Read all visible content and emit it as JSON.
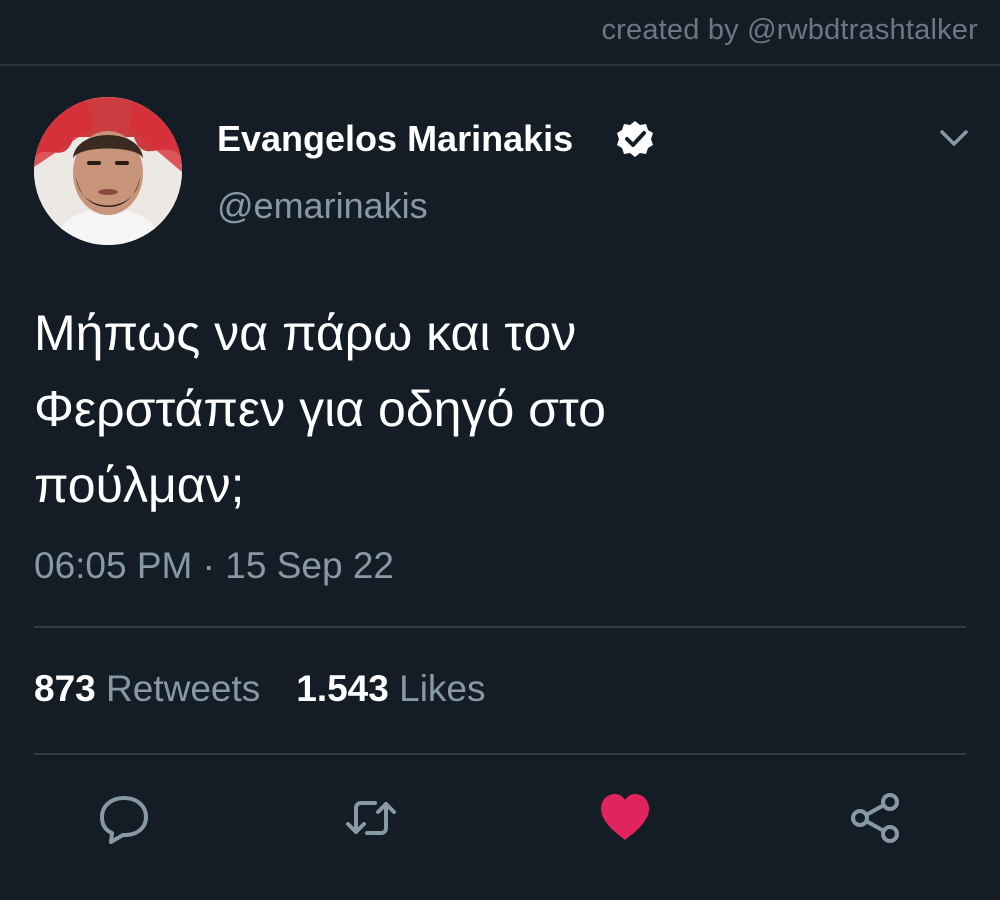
{
  "watermark": "created by @rwbdtrashtalker",
  "author": {
    "display_name": "Evangelos Marinakis",
    "handle": "@emarinakis",
    "verified": true,
    "avatar_icon": "profile-photo"
  },
  "tweet": {
    "text_lines": [
      "Μήπως να πάρω και τον",
      "Φερστάπεν για οδηγό στο",
      "πούλμαν;"
    ],
    "time": "06:05 PM",
    "separator": "·",
    "date": "15 Sep 22"
  },
  "stats": {
    "retweets_count": "873",
    "retweets_label": "Retweets",
    "likes_count": "1.543",
    "likes_label": "Likes"
  },
  "actions": {
    "reply_icon": "speech-bubble-icon",
    "retweet_icon": "retweet-arrows-icon",
    "like_icon": "heart-icon",
    "share_icon": "share-icon",
    "liked": true
  },
  "colors": {
    "background": "#141d26",
    "secondary_text": "#8899a6",
    "like": "#e0245e"
  }
}
